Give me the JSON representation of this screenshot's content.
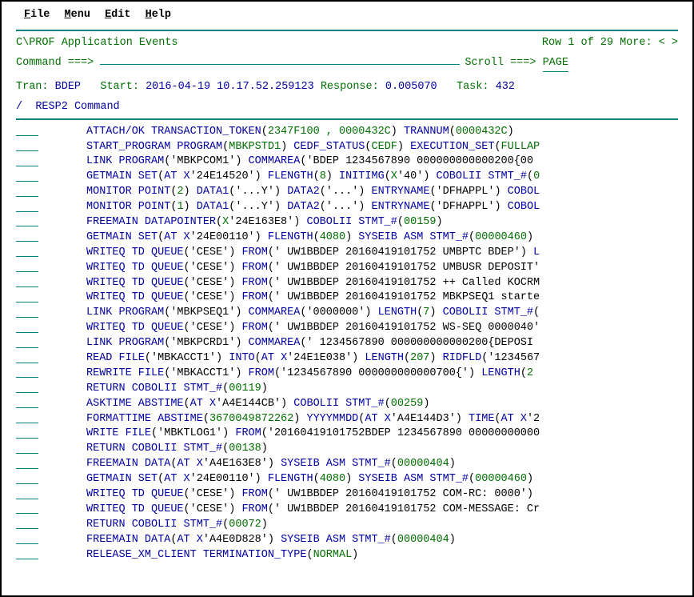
{
  "menu": {
    "items": [
      "File",
      "Menu",
      "Edit",
      "Help"
    ]
  },
  "title": "C\\PROF Application Events",
  "rowinfo": "Row 1 of 29 More: < >",
  "command_label": "Command ===>",
  "scroll_label": "Scroll ===>",
  "scroll_value": "PAGE",
  "hdr": {
    "tran_label": "Tran:",
    "tran_val": "BDEP",
    "start_label": "Start:",
    "start_val": "2016-04-19 10.17.52.259123",
    "resp_label": "Response:",
    "resp_val": "0.005070",
    "task_label": "Task:",
    "task_val": "432"
  },
  "col": {
    "slash": "/",
    "resp2": "RESP2",
    "command": "Command"
  },
  "events": [
    [
      [
        "cmd",
        "ATTACH/OK TRANSACTION_TOKEN"
      ],
      [
        "txt",
        "("
      ],
      [
        "arg",
        "2347F100 , 0000432C"
      ],
      [
        "txt",
        ") "
      ],
      [
        "cmd",
        "TRANNUM"
      ],
      [
        "txt",
        "("
      ],
      [
        "arg",
        "0000432C"
      ],
      [
        "txt",
        ")"
      ]
    ],
    [
      [
        "cmd",
        "START_PROGRAM PROGRAM"
      ],
      [
        "txt",
        "("
      ],
      [
        "arg",
        "MBKPSTD1"
      ],
      [
        "txt",
        ") "
      ],
      [
        "cmd",
        "CEDF_STATUS"
      ],
      [
        "txt",
        "("
      ],
      [
        "arg",
        "CEDF"
      ],
      [
        "txt",
        ") "
      ],
      [
        "cmd",
        "EXECUTION_SET"
      ],
      [
        "txt",
        "("
      ],
      [
        "arg",
        "FULLAP"
      ]
    ],
    [
      [
        "cmd",
        "LINK PROGRAM"
      ],
      [
        "txt",
        "('MBKPCOM1') "
      ],
      [
        "cmd",
        "COMMAREA"
      ],
      [
        "txt",
        "('BDEP 1234567890 000000000000200{00"
      ]
    ],
    [
      [
        "cmd",
        "GETMAIN SET"
      ],
      [
        "txt",
        "("
      ],
      [
        "cmd",
        "AT X"
      ],
      [
        "txt",
        "'24E14520') "
      ],
      [
        "cmd",
        "FLENGTH"
      ],
      [
        "txt",
        "("
      ],
      [
        "arg",
        "8"
      ],
      [
        "txt",
        ") "
      ],
      [
        "cmd",
        "INITIMG"
      ],
      [
        "txt",
        "("
      ],
      [
        "arg",
        "X"
      ],
      [
        "txt",
        "'40') "
      ],
      [
        "cmd",
        "COBOLII STMT_#"
      ],
      [
        "txt",
        "("
      ],
      [
        "arg",
        "0"
      ]
    ],
    [
      [
        "cmd",
        "MONITOR POINT"
      ],
      [
        "txt",
        "("
      ],
      [
        "arg",
        "2"
      ],
      [
        "txt",
        ") "
      ],
      [
        "cmd",
        "DATA1"
      ],
      [
        "txt",
        "('...Y') "
      ],
      [
        "cmd",
        "DATA2"
      ],
      [
        "txt",
        "('...') "
      ],
      [
        "cmd",
        "ENTRYNAME"
      ],
      [
        "txt",
        "('DFHAPPL') "
      ],
      [
        "cmd",
        "COBOL"
      ]
    ],
    [
      [
        "cmd",
        "MONITOR POINT"
      ],
      [
        "txt",
        "("
      ],
      [
        "arg",
        "1"
      ],
      [
        "txt",
        ") "
      ],
      [
        "cmd",
        "DATA1"
      ],
      [
        "txt",
        "('...Y') "
      ],
      [
        "cmd",
        "DATA2"
      ],
      [
        "txt",
        "('...') "
      ],
      [
        "cmd",
        "ENTRYNAME"
      ],
      [
        "txt",
        "('DFHAPPL') "
      ],
      [
        "cmd",
        "COBOL"
      ]
    ],
    [
      [
        "cmd",
        "FREEMAIN DATAPOINTER"
      ],
      [
        "txt",
        "("
      ],
      [
        "arg",
        "X"
      ],
      [
        "txt",
        "'24E163E8') "
      ],
      [
        "cmd",
        "COBOLII STMT_#"
      ],
      [
        "txt",
        "("
      ],
      [
        "arg",
        "00159"
      ],
      [
        "txt",
        ")"
      ]
    ],
    [
      [
        "cmd",
        "GETMAIN SET"
      ],
      [
        "txt",
        "("
      ],
      [
        "cmd",
        "AT X"
      ],
      [
        "txt",
        "'24E00110') "
      ],
      [
        "cmd",
        "FLENGTH"
      ],
      [
        "txt",
        "("
      ],
      [
        "arg",
        "4080"
      ],
      [
        "txt",
        ") "
      ],
      [
        "cmd",
        "SYSEIB ASM STMT_#"
      ],
      [
        "txt",
        "("
      ],
      [
        "arg",
        "00000460"
      ],
      [
        "txt",
        ")"
      ]
    ],
    [
      [
        "cmd",
        "WRITEQ TD QUEUE"
      ],
      [
        "txt",
        "('CESE') "
      ],
      [
        "cmd",
        "FROM"
      ],
      [
        "txt",
        "(' UW1BBDEP 20160419101752 UMBPTC BDEP') "
      ],
      [
        "cmd",
        "L"
      ]
    ],
    [
      [
        "cmd",
        "WRITEQ TD QUEUE"
      ],
      [
        "txt",
        "('CESE') "
      ],
      [
        "cmd",
        "FROM"
      ],
      [
        "txt",
        "(' UW1BBDEP 20160419101752 UMBUSR DEPOSIT'"
      ]
    ],
    [
      [
        "cmd",
        "WRITEQ TD QUEUE"
      ],
      [
        "txt",
        "('CESE') "
      ],
      [
        "cmd",
        "FROM"
      ],
      [
        "txt",
        "(' UW1BBDEP 20160419101752 ++ Called KOCRM"
      ]
    ],
    [
      [
        "cmd",
        "WRITEQ TD QUEUE"
      ],
      [
        "txt",
        "('CESE') "
      ],
      [
        "cmd",
        "FROM"
      ],
      [
        "txt",
        "(' UW1BBDEP 20160419101752 MBKPSEQ1 starte"
      ]
    ],
    [
      [
        "cmd",
        "LINK PROGRAM"
      ],
      [
        "txt",
        "('MBKPSEQ1') "
      ],
      [
        "cmd",
        "COMMAREA"
      ],
      [
        "txt",
        "('0000000') "
      ],
      [
        "cmd",
        "LENGTH"
      ],
      [
        "txt",
        "("
      ],
      [
        "arg",
        "7"
      ],
      [
        "txt",
        ") "
      ],
      [
        "cmd",
        "COBOLII STMT_#"
      ],
      [
        "txt",
        "("
      ]
    ],
    [
      [
        "cmd",
        "WRITEQ TD QUEUE"
      ],
      [
        "txt",
        "('CESE') "
      ],
      [
        "cmd",
        "FROM"
      ],
      [
        "txt",
        "(' UW1BBDEP 20160419101752 WS-SEQ 0000040'"
      ]
    ],
    [
      [
        "cmd",
        "LINK PROGRAM"
      ],
      [
        "txt",
        "('MBKPCRD1') "
      ],
      [
        "cmd",
        "COMMAREA"
      ],
      [
        "txt",
        "(' 1234567890 000000000000200{DEPOSI"
      ]
    ],
    [
      [
        "cmd",
        "READ FILE"
      ],
      [
        "txt",
        "('MBKACCT1') "
      ],
      [
        "cmd",
        "INTO"
      ],
      [
        "txt",
        "("
      ],
      [
        "cmd",
        "AT X"
      ],
      [
        "txt",
        "'24E1E038') "
      ],
      [
        "cmd",
        "LENGTH"
      ],
      [
        "txt",
        "("
      ],
      [
        "arg",
        "207"
      ],
      [
        "txt",
        ") "
      ],
      [
        "cmd",
        "RIDFLD"
      ],
      [
        "txt",
        "('1234567"
      ]
    ],
    [
      [
        "cmd",
        "REWRITE FILE"
      ],
      [
        "txt",
        "('MBKACCT1') "
      ],
      [
        "cmd",
        "FROM"
      ],
      [
        "txt",
        "('1234567890 000000000000700{') "
      ],
      [
        "cmd",
        "LENGTH"
      ],
      [
        "txt",
        "("
      ],
      [
        "arg",
        "2"
      ]
    ],
    [
      [
        "cmd",
        "RETURN COBOLII STMT_#"
      ],
      [
        "txt",
        "("
      ],
      [
        "arg",
        "00119"
      ],
      [
        "txt",
        ")"
      ]
    ],
    [
      [
        "cmd",
        "ASKTIME ABSTIME"
      ],
      [
        "txt",
        "("
      ],
      [
        "cmd",
        "AT X"
      ],
      [
        "txt",
        "'A4E144CB') "
      ],
      [
        "cmd",
        "COBOLII STMT_#"
      ],
      [
        "txt",
        "("
      ],
      [
        "arg",
        "00259"
      ],
      [
        "txt",
        ")"
      ]
    ],
    [
      [
        "cmd",
        "FORMATTIME ABSTIME"
      ],
      [
        "txt",
        "("
      ],
      [
        "arg",
        "3670049872262"
      ],
      [
        "txt",
        ") "
      ],
      [
        "cmd",
        "YYYYMMDD"
      ],
      [
        "txt",
        "("
      ],
      [
        "cmd",
        "AT X"
      ],
      [
        "txt",
        "'A4E144D3') "
      ],
      [
        "cmd",
        "TIME"
      ],
      [
        "txt",
        "("
      ],
      [
        "cmd",
        "AT X"
      ],
      [
        "txt",
        "'2"
      ]
    ],
    [
      [
        "cmd",
        "WRITE FILE"
      ],
      [
        "txt",
        "('MBKTLOG1') "
      ],
      [
        "cmd",
        "FROM"
      ],
      [
        "txt",
        "('20160419101752BDEP 1234567890 00000000000"
      ]
    ],
    [
      [
        "cmd",
        "RETURN COBOLII STMT_#"
      ],
      [
        "txt",
        "("
      ],
      [
        "arg",
        "00138"
      ],
      [
        "txt",
        ")"
      ]
    ],
    [
      [
        "cmd",
        "FREEMAIN DATA"
      ],
      [
        "txt",
        "("
      ],
      [
        "cmd",
        "AT X"
      ],
      [
        "txt",
        "'A4E163E8') "
      ],
      [
        "cmd",
        "SYSEIB ASM STMT_#"
      ],
      [
        "txt",
        "("
      ],
      [
        "arg",
        "00000404"
      ],
      [
        "txt",
        ")"
      ]
    ],
    [
      [
        "cmd",
        "GETMAIN SET"
      ],
      [
        "txt",
        "("
      ],
      [
        "cmd",
        "AT X"
      ],
      [
        "txt",
        "'24E00110') "
      ],
      [
        "cmd",
        "FLENGTH"
      ],
      [
        "txt",
        "("
      ],
      [
        "arg",
        "4080"
      ],
      [
        "txt",
        ") "
      ],
      [
        "cmd",
        "SYSEIB ASM STMT_#"
      ],
      [
        "txt",
        "("
      ],
      [
        "arg",
        "00000460"
      ],
      [
        "txt",
        ")"
      ]
    ],
    [
      [
        "cmd",
        "WRITEQ TD QUEUE"
      ],
      [
        "txt",
        "('CESE') "
      ],
      [
        "cmd",
        "FROM"
      ],
      [
        "txt",
        "(' UW1BBDEP 20160419101752 COM-RC: 0000')"
      ]
    ],
    [
      [
        "cmd",
        "WRITEQ TD QUEUE"
      ],
      [
        "txt",
        "('CESE') "
      ],
      [
        "cmd",
        "FROM"
      ],
      [
        "txt",
        "(' UW1BBDEP 20160419101752 COM-MESSAGE: Cr"
      ]
    ],
    [
      [
        "cmd",
        "RETURN COBOLII STMT_#"
      ],
      [
        "txt",
        "("
      ],
      [
        "arg",
        "00072"
      ],
      [
        "txt",
        ")"
      ]
    ],
    [
      [
        "cmd",
        "FREEMAIN DATA"
      ],
      [
        "txt",
        "("
      ],
      [
        "cmd",
        "AT X"
      ],
      [
        "txt",
        "'A4E0D828') "
      ],
      [
        "cmd",
        "SYSEIB ASM STMT_#"
      ],
      [
        "txt",
        "("
      ],
      [
        "arg",
        "00000404"
      ],
      [
        "txt",
        ")"
      ]
    ],
    [
      [
        "cmd",
        "RELEASE_XM_CLIENT TERMINATION_TYPE"
      ],
      [
        "txt",
        "("
      ],
      [
        "arg",
        "NORMAL"
      ],
      [
        "txt",
        ")"
      ]
    ]
  ]
}
